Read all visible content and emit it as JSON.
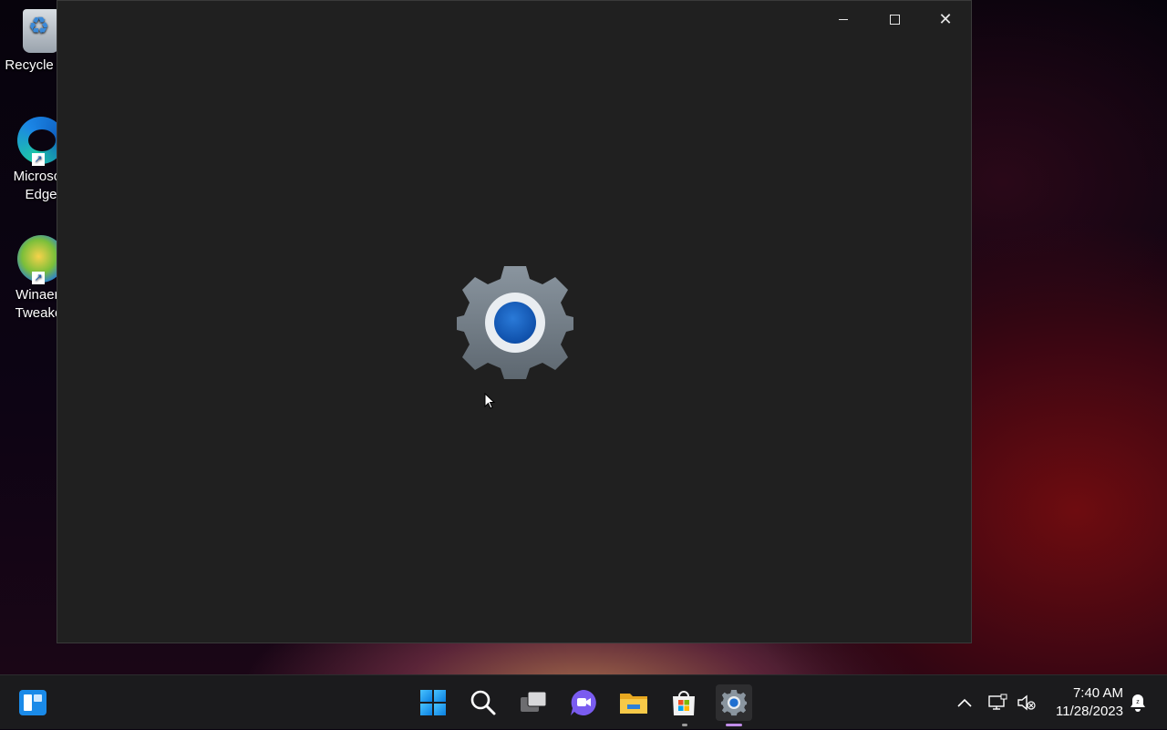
{
  "desktop": {
    "icons": [
      {
        "label": "Recycle Bin",
        "icon": "recycle-bin-icon"
      },
      {
        "label": "Microsoft Edge",
        "icon": "edge-icon"
      },
      {
        "label": "Winaero Tweaker",
        "icon": "winaero-tweaker-icon"
      }
    ]
  },
  "window": {
    "app": "Settings",
    "splash_icon": "settings-gear-icon",
    "controls": {
      "minimize": "minimize",
      "maximize": "maximize",
      "close": "close"
    }
  },
  "taskbar": {
    "items": [
      "widgets-icon",
      "start-icon",
      "search-icon",
      "task-view-icon",
      "chat-icon",
      "file-explorer-icon",
      "microsoft-store-icon",
      "settings-icon"
    ],
    "tray": {
      "time": "7:40 AM",
      "date": "11/28/2023"
    }
  },
  "colors": {
    "window_bg": "#202020",
    "taskbar_bg": "#1b1b1d",
    "accent": "#1f6fd0",
    "active_indicator": "#c08ce8"
  }
}
